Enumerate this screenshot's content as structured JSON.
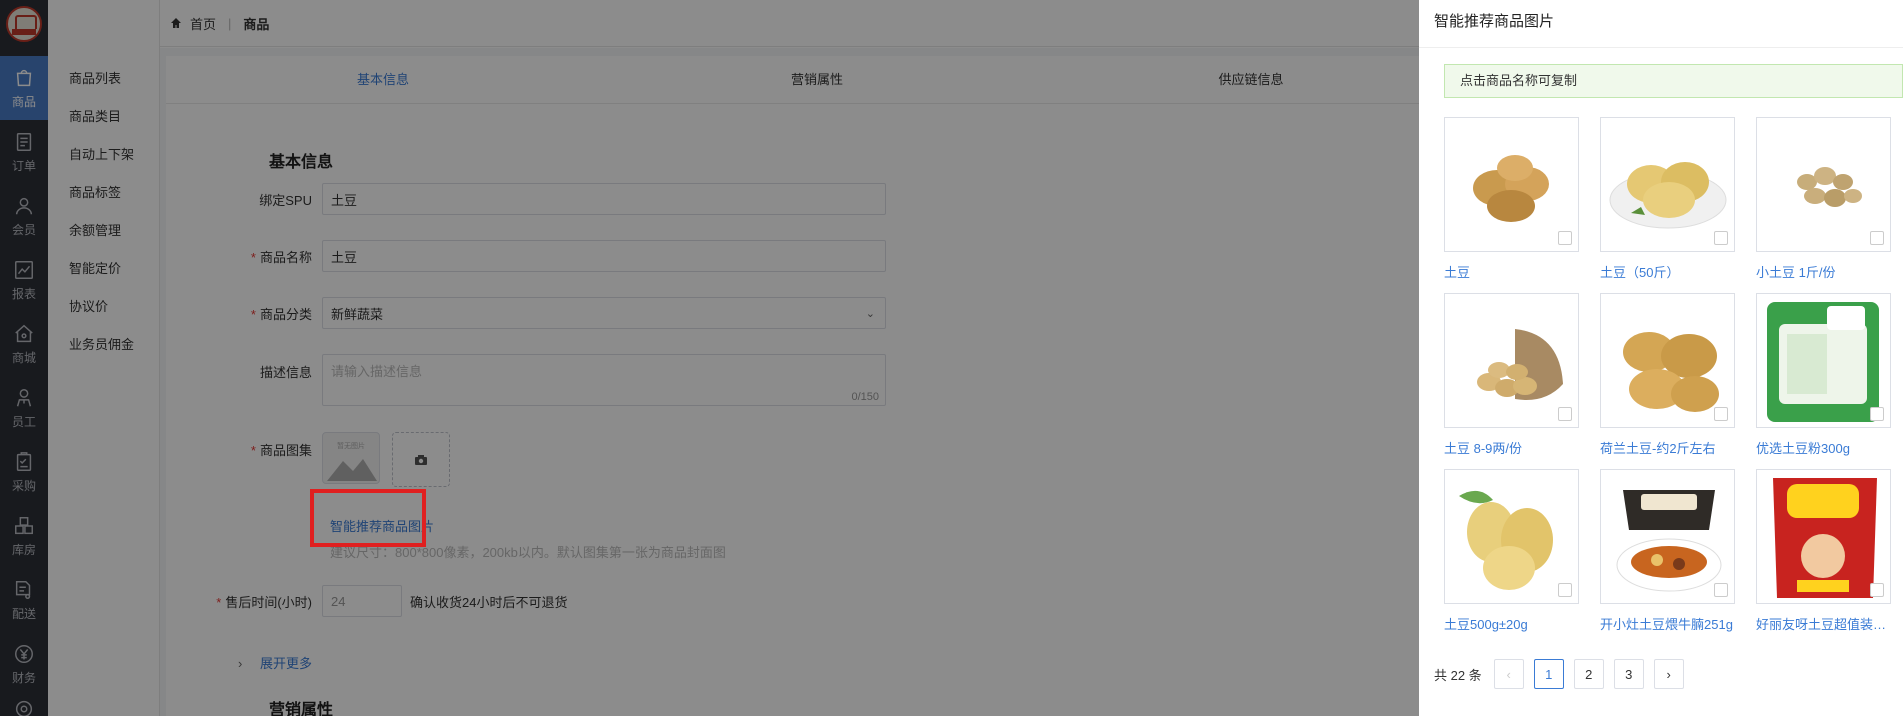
{
  "breadcrumb": {
    "home": "首页",
    "current": "商品"
  },
  "rail": [
    {
      "label": "商品",
      "icon": "bag-icon",
      "active": true
    },
    {
      "label": "订单",
      "icon": "order-icon"
    },
    {
      "label": "会员",
      "icon": "user-icon"
    },
    {
      "label": "报表",
      "icon": "chart-icon"
    },
    {
      "label": "商城",
      "icon": "shop-icon"
    },
    {
      "label": "员工",
      "icon": "staff-icon"
    },
    {
      "label": "采购",
      "icon": "clipboard-icon"
    },
    {
      "label": "库房",
      "icon": "warehouse-icon"
    },
    {
      "label": "配送",
      "icon": "delivery-icon"
    },
    {
      "label": "财务",
      "icon": "yen-icon"
    }
  ],
  "subnav": [
    "商品列表",
    "商品类目",
    "自动上下架",
    "商品标签",
    "余额管理",
    "智能定价",
    "协议价",
    "业务员佣金"
  ],
  "tabs": [
    "基本信息",
    "营销属性",
    "供应链信息"
  ],
  "form": {
    "section_title": "基本信息",
    "spu_label": "绑定SPU",
    "spu_value": "土豆",
    "name_label": "商品名称",
    "name_value": "土豆",
    "category_label": "商品分类",
    "category_value": "新鲜蔬菜",
    "desc_label": "描述信息",
    "desc_placeholder": "请输入描述信息",
    "desc_counter": "0/150",
    "gallery_label": "商品图集",
    "placeholder_text": "暂无图片",
    "smart_link": "智能推荐商品图片",
    "hint": "建议尺寸：800*800像素，200kb以内。默认图集第一张为商品封面图",
    "aftersale_label": "售后时间(小时)",
    "aftersale_value": "24",
    "aftersale_note": "确认收货24小时后不可退货",
    "expand": "展开更多",
    "section_title_2": "营销属性"
  },
  "drawer": {
    "title": "智能推荐商品图片",
    "notice": "点击商品名称可复制",
    "items": [
      {
        "name": "土豆"
      },
      {
        "name": "土豆（50斤）"
      },
      {
        "name": "小土豆 1斤/份"
      },
      {
        "name": "土豆 8-9两/份"
      },
      {
        "name": "荷兰土豆-约2斤左右"
      },
      {
        "name": "优选土豆粉300g"
      },
      {
        "name": "土豆500g±20g"
      },
      {
        "name": "开小灶土豆煨牛腩251g"
      },
      {
        "name": "好丽友呀土豆超值装番茄味"
      }
    ],
    "pager": {
      "total": "共 22 条",
      "pages": [
        "1",
        "2",
        "3"
      ],
      "current": "1"
    }
  },
  "colors": {
    "accent": "#3a7bd5",
    "rail": "#2d3038",
    "highlight": "#e02020"
  }
}
